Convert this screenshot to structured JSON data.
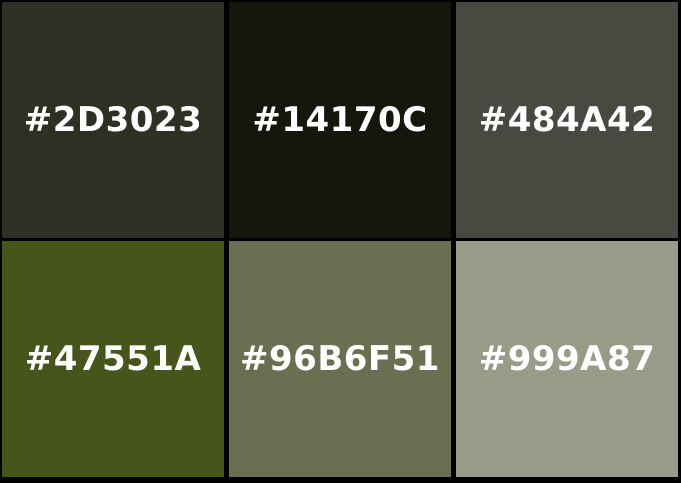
{
  "swatches": [
    {
      "label": "#2D3023",
      "color": "#2D3023"
    },
    {
      "label": "#14170C",
      "color": "#14170C"
    },
    {
      "label": "#484A42",
      "color": "#484A42"
    },
    {
      "label": "#47551A",
      "color": "#47551A"
    },
    {
      "label": "#96B6F51",
      "color": "#6B6F51"
    },
    {
      "label": "#999A87",
      "color": "#999A87"
    }
  ]
}
